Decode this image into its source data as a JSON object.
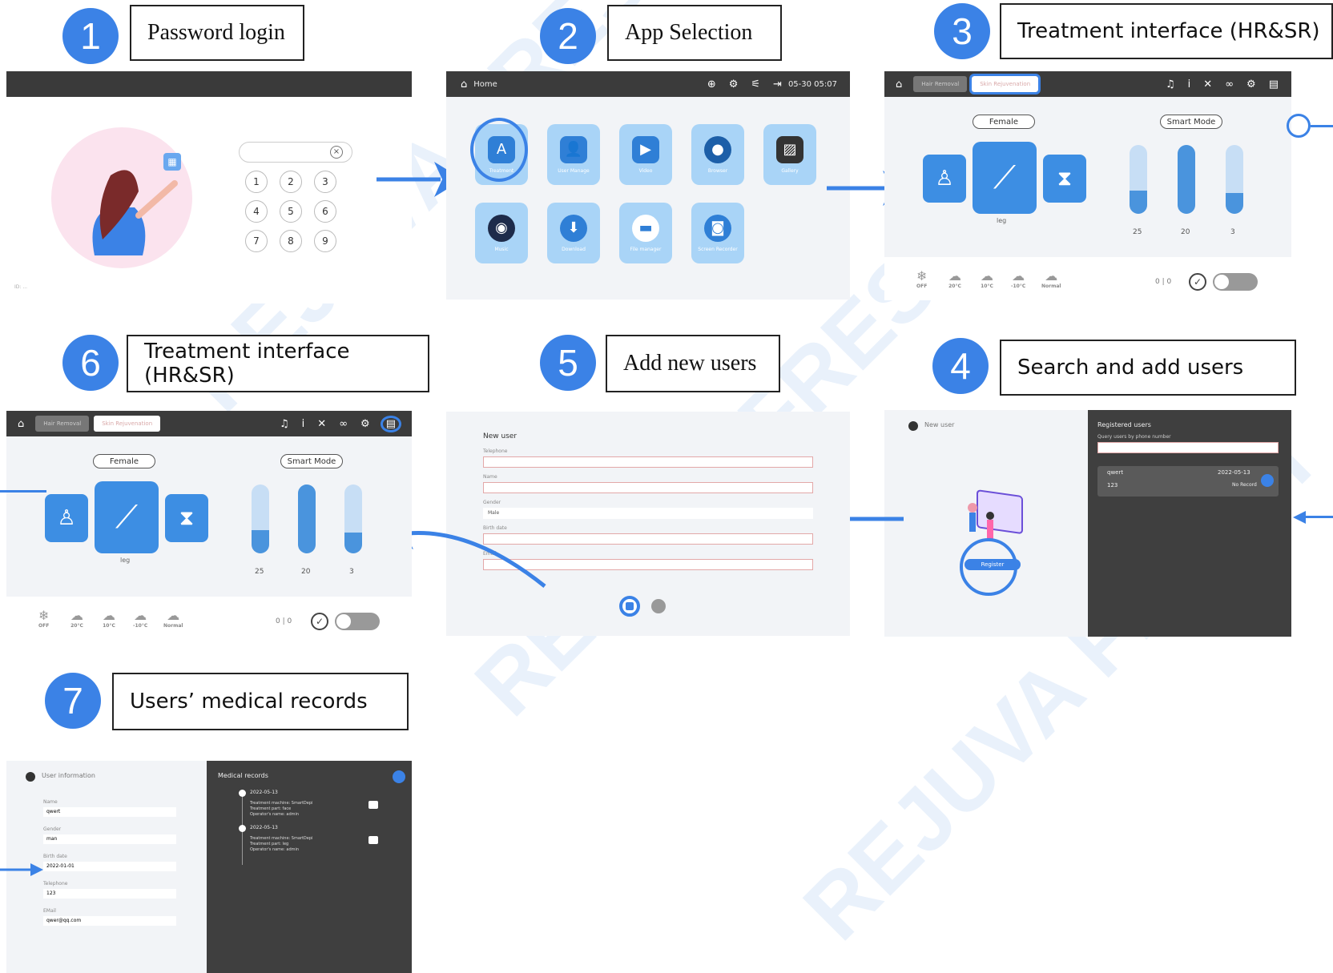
{
  "colors": {
    "accent": "#3b82e6",
    "dark_panel": "#3f3f3f",
    "light_panel": "#f2f4f7",
    "tile": "#a9d4f7",
    "watermark": "#e8f1fb"
  },
  "watermark": "REJUVA FRESH",
  "steps": [
    {
      "num": "1",
      "label": "Password login"
    },
    {
      "num": "2",
      "label": "App Selection"
    },
    {
      "num": "3",
      "label": "Treatment interface (HR&SR)"
    },
    {
      "num": "4",
      "label": "Search and add users"
    },
    {
      "num": "5",
      "label": "Add new users"
    },
    {
      "num": "6",
      "label": "Treatment interface (HR&SR)"
    },
    {
      "num": "7",
      "label": "Users’ medical records"
    }
  ],
  "login": {
    "keys": [
      "1",
      "2",
      "3",
      "4",
      "5",
      "6",
      "7",
      "8",
      "9"
    ],
    "clear_icon": "close-circle-icon",
    "footer": "ID: ...",
    "avatar_icon": "woman-illustration"
  },
  "home": {
    "title": "Home",
    "time": "05-30 05:07",
    "apps": [
      "Treatment",
      "User Manage",
      "Video",
      "Browser",
      "Gallery",
      "Music",
      "Download",
      "File manager",
      "Screen Recorder"
    ]
  },
  "treatment": {
    "tabs": [
      "Hair Removal",
      "Skin Rejuvenation"
    ],
    "gender": "Female",
    "mode": "Smart Mode",
    "part": "leg",
    "values": [
      "25",
      "20",
      "3"
    ],
    "levels": [
      0.3,
      1.0,
      0.3
    ],
    "counter": "0 | 0",
    "cool_labels": [
      "OFF",
      "20°C",
      "10°C",
      "-10°C",
      "Normal"
    ]
  },
  "search": {
    "back": "New user",
    "register": "Register",
    "panel_title": "Registered users",
    "hint": "Query users by phone number",
    "user_name": "qwert",
    "user_phone": "123",
    "user_date": "2022-05-13",
    "user_status": "No Record"
  },
  "newuser": {
    "title": "New user",
    "fields": [
      "Telephone",
      "Name",
      "Gender",
      "Birth date",
      "Email"
    ],
    "gender_value": "Male"
  },
  "records": {
    "back": "User information",
    "fields": [
      {
        "label": "Name",
        "value": "qwert"
      },
      {
        "label": "Gender",
        "value": "man"
      },
      {
        "label": "Birth date",
        "value": "2022-01-01"
      },
      {
        "label": "Telephone",
        "value": "123"
      },
      {
        "label": "EMail",
        "value": "qwer@qq.com"
      }
    ],
    "title": "Medical records",
    "entries": [
      {
        "date": "2022-05-13",
        "lines": [
          "Treatment machine: SmartDepi",
          "Treatment part: face",
          "Operator's name: admin"
        ]
      },
      {
        "date": "2022-05-13",
        "lines": [
          "Treatment machine: SmartDepi",
          "Treatment part: leg",
          "Operator's name: admin"
        ]
      }
    ]
  }
}
